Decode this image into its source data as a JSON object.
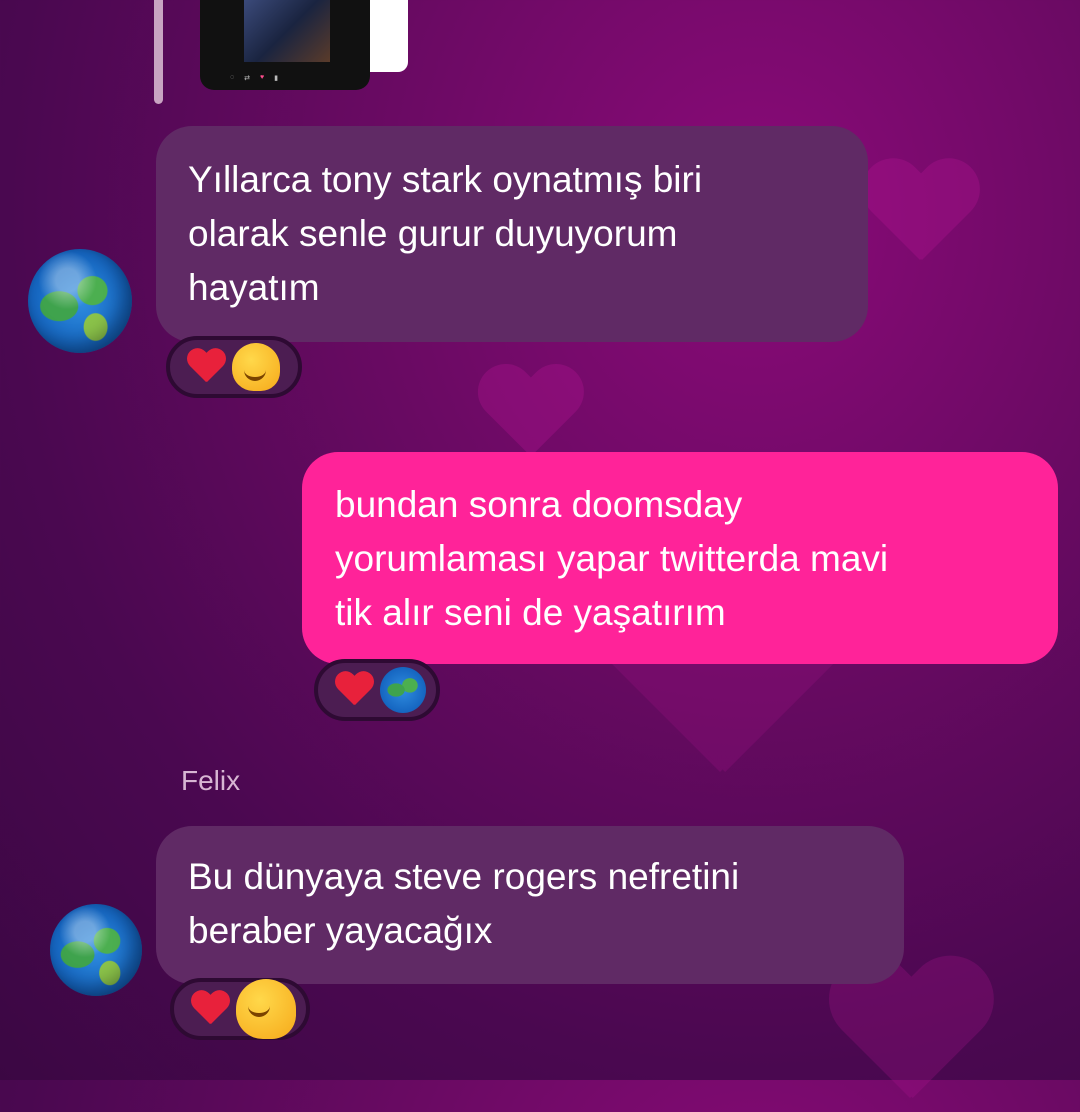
{
  "conversation": {
    "messages": [
      {
        "direction": "incoming",
        "text_lines": [
          "Yıllarca tony stark oynatmış biri",
          "olarak senle gurur duyuyorum",
          "hayatım"
        ],
        "reactions": [
          "heart",
          "melting-face"
        ]
      },
      {
        "direction": "outgoing",
        "text_lines": [
          "bundan sonra doomsday",
          "yorumlaması yapar twitterda mavi",
          "tik alır seni de yaşatırım"
        ],
        "reactions": [
          "heart",
          "globe"
        ]
      },
      {
        "sender": "Felix",
        "direction": "incoming",
        "text_lines": [
          "Bu dünyaya steve rogers nefretini",
          "beraber yayacağıx"
        ],
        "reactions": [
          "heart",
          "melting-face"
        ]
      }
    ]
  },
  "colors": {
    "incoming_bubble": "#602a65",
    "outgoing_bubble": "#ff2399",
    "background": "#4a0850"
  },
  "icons": {
    "avatar": "globe-avatar",
    "reaction_heart": "red-heart-icon",
    "reaction_melt": "melting-face-icon",
    "reaction_globe": "globe-icon"
  }
}
